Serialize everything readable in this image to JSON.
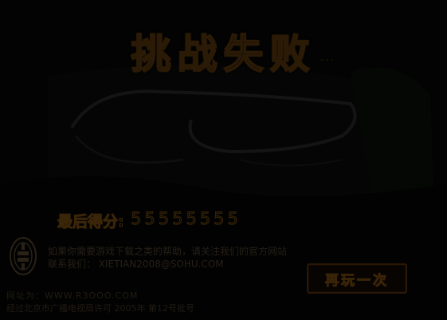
{
  "title": "挑战失败",
  "title_suffix": "...",
  "score": {
    "label": "最后得分:",
    "value": "55555555"
  },
  "message": "如果你需要游戏下载之类的帮助，请关注我们的官方网站",
  "contact": "联系我们：  XIETIAN2008@SOHU.COM",
  "retry_button": {
    "label": "再玩一次"
  },
  "footer": {
    "url": "网址为：WWW.R3OOO.COM",
    "license": "经过北京市广播电视局许可 2005年 第12号批号"
  },
  "colors": {
    "background": "#020302",
    "title_outline": "#2a1a06",
    "text_dim": "#272018",
    "button_border": "#2a1706"
  },
  "icons": {
    "emblem": "circular-seal-emblem-icon"
  }
}
